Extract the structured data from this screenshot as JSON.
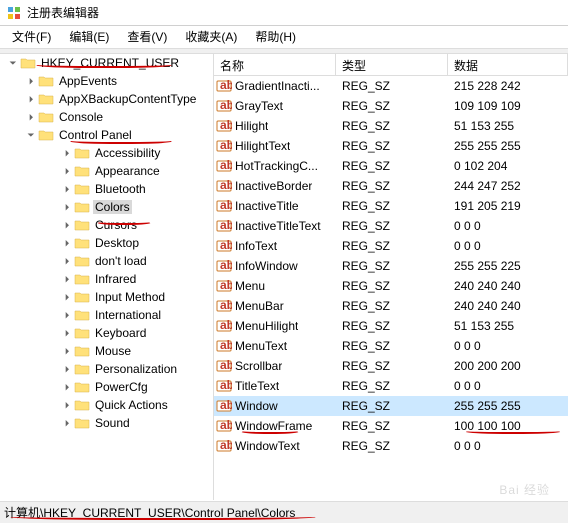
{
  "window": {
    "title": "注册表编辑器"
  },
  "menubar": [
    "文件(F)",
    "编辑(E)",
    "查看(V)",
    "收藏夹(A)",
    "帮助(H)"
  ],
  "tree": {
    "root": "HKEY_CURRENT_USER",
    "level1": [
      {
        "label": "AppEvents",
        "chev": "right"
      },
      {
        "label": "AppXBackupContentType",
        "chev": "right"
      },
      {
        "label": "Console",
        "chev": "right"
      },
      {
        "label": "Control Panel",
        "chev": "down",
        "expanded": true
      }
    ],
    "controlPanelChildren": [
      "Accessibility",
      "Appearance",
      "Bluetooth",
      "Colors",
      "Cursors",
      "Desktop",
      "don't load",
      "Infrared",
      "Input Method",
      "International",
      "Keyboard",
      "Mouse",
      "Personalization",
      "PowerCfg",
      "Quick Actions",
      "Sound"
    ],
    "selectedChild": "Colors"
  },
  "listHeader": {
    "name": "名称",
    "type": "类型",
    "data": "数据"
  },
  "values": [
    {
      "name": "GradientInacti...",
      "type": "REG_SZ",
      "data": "215 228 242"
    },
    {
      "name": "GrayText",
      "type": "REG_SZ",
      "data": "109 109 109"
    },
    {
      "name": "Hilight",
      "type": "REG_SZ",
      "data": "51 153 255"
    },
    {
      "name": "HilightText",
      "type": "REG_SZ",
      "data": "255 255 255"
    },
    {
      "name": "HotTrackingC...",
      "type": "REG_SZ",
      "data": "0 102 204"
    },
    {
      "name": "InactiveBorder",
      "type": "REG_SZ",
      "data": "244 247 252"
    },
    {
      "name": "InactiveTitle",
      "type": "REG_SZ",
      "data": "191 205 219"
    },
    {
      "name": "InactiveTitleText",
      "type": "REG_SZ",
      "data": "0 0 0"
    },
    {
      "name": "InfoText",
      "type": "REG_SZ",
      "data": "0 0 0"
    },
    {
      "name": "InfoWindow",
      "type": "REG_SZ",
      "data": "255 255 225"
    },
    {
      "name": "Menu",
      "type": "REG_SZ",
      "data": "240 240 240"
    },
    {
      "name": "MenuBar",
      "type": "REG_SZ",
      "data": "240 240 240"
    },
    {
      "name": "MenuHilight",
      "type": "REG_SZ",
      "data": "51 153 255"
    },
    {
      "name": "MenuText",
      "type": "REG_SZ",
      "data": "0 0 0"
    },
    {
      "name": "Scrollbar",
      "type": "REG_SZ",
      "data": "200 200 200"
    },
    {
      "name": "TitleText",
      "type": "REG_SZ",
      "data": "0 0 0"
    },
    {
      "name": "Window",
      "type": "REG_SZ",
      "data": "255 255 255",
      "selected": true
    },
    {
      "name": "WindowFrame",
      "type": "REG_SZ",
      "data": "100 100 100"
    },
    {
      "name": "WindowText",
      "type": "REG_SZ",
      "data": "0 0 0"
    }
  ],
  "statusbar": "计算机\\HKEY_CURRENT_USER\\Control Panel\\Colors",
  "watermark": "Bai    经验"
}
